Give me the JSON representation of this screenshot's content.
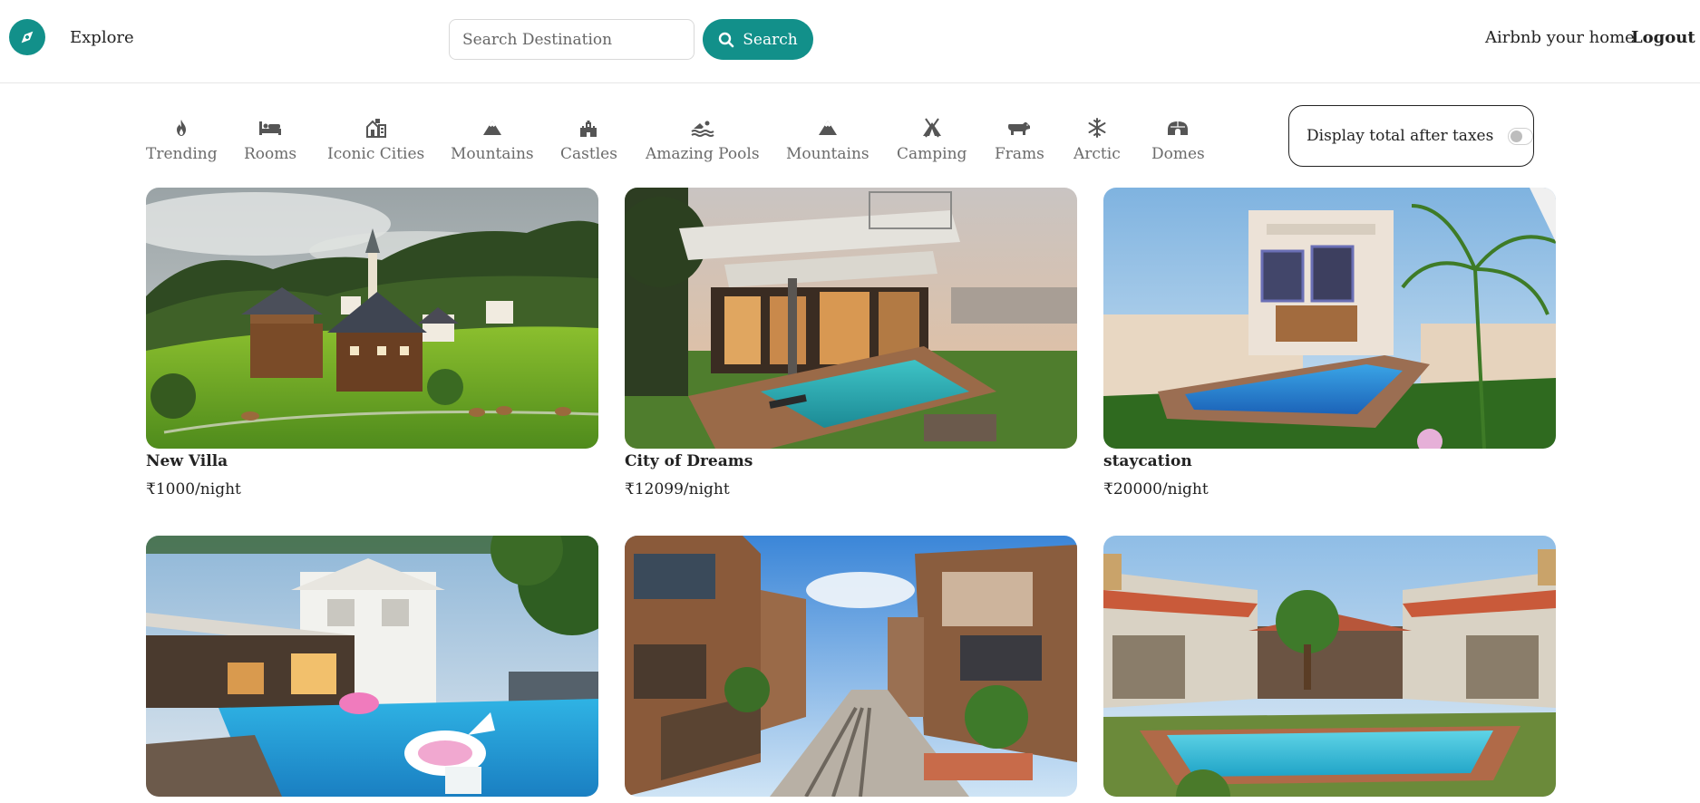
{
  "navbar": {
    "explore": "Explore",
    "search_placeholder": "Search Destination",
    "search_button": "Search",
    "host": "Airbnb your home",
    "logout": "Logout"
  },
  "filters": [
    {
      "label": "Trending",
      "icon": "fire-icon"
    },
    {
      "label": "Rooms",
      "icon": "bed-icon"
    },
    {
      "label": "Iconic Cities",
      "icon": "city-icon"
    },
    {
      "label": "Mountains",
      "icon": "mountain-icon"
    },
    {
      "label": "Castles",
      "icon": "castle-icon"
    },
    {
      "label": "Amazing Pools",
      "icon": "swimmer-icon"
    },
    {
      "label": "Mountains",
      "icon": "mountain-icon"
    },
    {
      "label": "Camping",
      "icon": "tent-icon"
    },
    {
      "label": "Frams",
      "icon": "cow-icon"
    },
    {
      "label": "Arctic",
      "icon": "snowflake-icon"
    },
    {
      "label": "Domes",
      "icon": "igloo-icon"
    }
  ],
  "tax_toggle": {
    "label": "Display total after taxes",
    "enabled": false
  },
  "listings": [
    {
      "title": "New Villa",
      "price": "₹1000/night"
    },
    {
      "title": "City of Dreams",
      "price": "₹12099/night"
    },
    {
      "title": "staycation",
      "price": "₹20000/night"
    },
    {
      "title": "",
      "price": ""
    },
    {
      "title": "",
      "price": ""
    },
    {
      "title": "",
      "price": ""
    }
  ],
  "colors": {
    "brand": "#12908a",
    "text": "#222222",
    "muted": "#6b6b6b"
  }
}
